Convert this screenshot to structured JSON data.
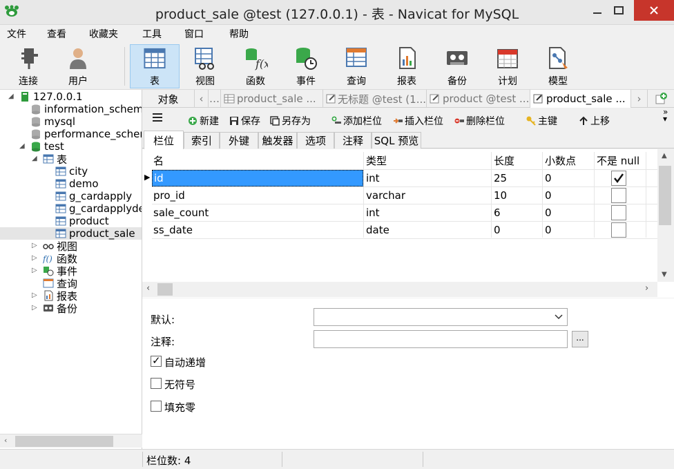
{
  "window": {
    "title": "product_sale @test (127.0.0.1) - 表 - Navicat for MySQL"
  },
  "menu": [
    "文件",
    "查看",
    "收藏夹",
    "工具",
    "窗口",
    "帮助"
  ],
  "toolbar": {
    "connect": "连接",
    "user": "用户",
    "table": "表",
    "view": "视图",
    "function": "函数",
    "event": "事件",
    "query": "查询",
    "report": "报表",
    "backup": "备份",
    "schedule": "计划",
    "model": "模型"
  },
  "tree": {
    "server": "127.0.0.1",
    "databases": [
      "information_schema",
      "mysql",
      "performance_schema",
      "test"
    ],
    "tables_label": "表",
    "tables": [
      "city",
      "demo",
      "g_cardapply",
      "g_cardapplydetail",
      "product",
      "product_sale"
    ],
    "views_label": "视图",
    "functions_label": "函数",
    "events_label": "事件",
    "queries_label": "查询",
    "reports_label": "报表",
    "backups_label": "备份"
  },
  "tabs": {
    "objects": "对象",
    "tab1": "product_sale ...",
    "tab2": "无标题 @test (1...",
    "tab3": "product @test ...",
    "tab4": "product_sale ..."
  },
  "inner_toolbar": {
    "new": "新建",
    "save": "保存",
    "save_as": "另存为",
    "add_field": "添加栏位",
    "insert_field": "插入栏位",
    "delete_field": "删除栏位",
    "primary_key": "主键",
    "move_up": "上移"
  },
  "design_tabs": [
    "栏位",
    "索引",
    "外键",
    "触发器",
    "选项",
    "注释",
    "SQL 预览"
  ],
  "grid": {
    "headers": [
      "名",
      "类型",
      "长度",
      "小数点",
      "不是 null"
    ],
    "rows": [
      {
        "name": "id",
        "type": "int",
        "length": "25",
        "decimals": "0",
        "not_null": true
      },
      {
        "name": "pro_id",
        "type": "varchar",
        "length": "10",
        "decimals": "0",
        "not_null": false
      },
      {
        "name": "sale_count",
        "type": "int",
        "length": "6",
        "decimals": "0",
        "not_null": false
      },
      {
        "name": "ss_date",
        "type": "date",
        "length": "0",
        "decimals": "0",
        "not_null": false
      }
    ]
  },
  "properties": {
    "default_label": "默认:",
    "default_value": "",
    "comment_label": "注释:",
    "comment_value": "",
    "ellipsis": "...",
    "auto_increment": "自动递增",
    "auto_increment_checked": true,
    "unsigned": "无符号",
    "unsigned_checked": false,
    "zerofill": "填充零",
    "zerofill_checked": false
  },
  "status": {
    "field_count": "栏位数: 4"
  },
  "colors": {
    "selection": "#3399ff",
    "close": "#c7352b",
    "active_tool": "#cce4f7"
  }
}
